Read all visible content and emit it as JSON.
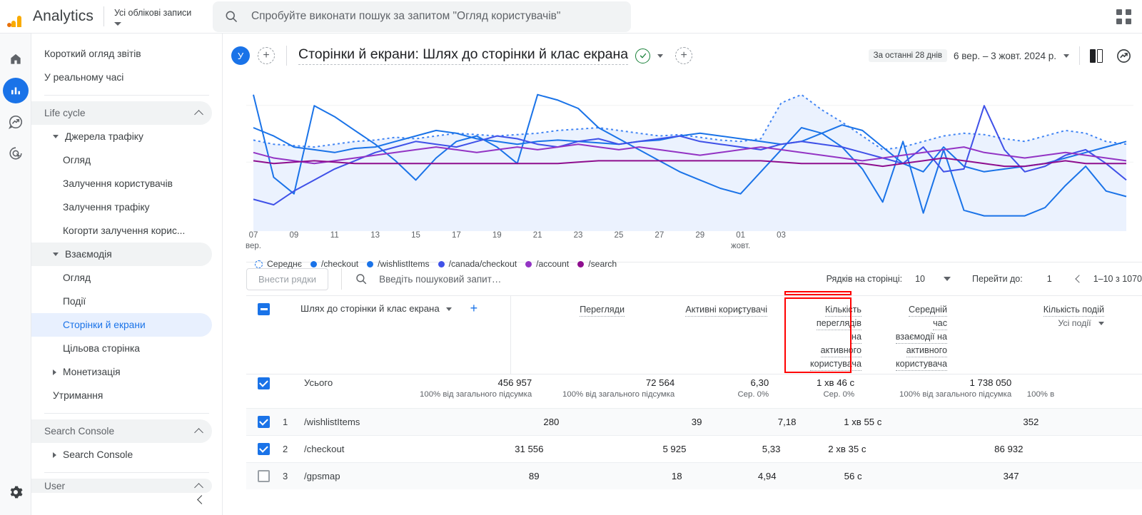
{
  "topbar": {
    "brand": "Analytics",
    "account_selector": "Усі облікові записи",
    "search_placeholder": "Спробуйте виконати пошук за запитом \"Огляд користувачів\"",
    "search_value": ""
  },
  "rail": {
    "items": [
      {
        "name": "home-icon",
        "label": "Home"
      },
      {
        "name": "reports-icon",
        "label": "Reports"
      },
      {
        "name": "explore-icon",
        "label": "Explore"
      },
      {
        "name": "advertising-icon",
        "label": "Advertising"
      }
    ],
    "settings_label": "Адміністратор"
  },
  "sidebar": {
    "items": [
      {
        "label": "Короткий огляд звітів",
        "level": 0,
        "type": "link"
      },
      {
        "label": "У реальному часі",
        "level": 0,
        "type": "link"
      },
      {
        "label": "Life cycle",
        "level": 0,
        "type": "group",
        "collapsed": false
      },
      {
        "label": "Джерела трафіку",
        "level": 1,
        "type": "expandable",
        "expanded": true
      },
      {
        "label": "Огляд",
        "level": 2,
        "type": "link"
      },
      {
        "label": "Залучення користувачів",
        "level": 2,
        "type": "link"
      },
      {
        "label": "Залучення трафіку",
        "level": 2,
        "type": "link"
      },
      {
        "label": "Когорти залучення корис...",
        "level": 2,
        "type": "link"
      },
      {
        "label": "Взаємодія",
        "level": 1,
        "type": "expandable",
        "expanded": true
      },
      {
        "label": "Огляд",
        "level": 2,
        "type": "link"
      },
      {
        "label": "Події",
        "level": 2,
        "type": "link"
      },
      {
        "label": "Сторінки й екрани",
        "level": 2,
        "type": "link",
        "selected": true
      },
      {
        "label": "Цільова сторінка",
        "level": 2,
        "type": "link"
      },
      {
        "label": "Монетизація",
        "level": 1,
        "type": "expandable",
        "expanded": false
      },
      {
        "label": "Утримання",
        "level": 1,
        "type": "link"
      },
      {
        "label": "Search Console",
        "level": 0,
        "type": "group",
        "collapsed": false
      },
      {
        "label": "Search Console",
        "level": 1,
        "type": "expandable",
        "expanded": false
      },
      {
        "label": "User",
        "level": 0,
        "type": "group",
        "collapsed": false
      }
    ]
  },
  "page_header": {
    "avatar_initial": "У",
    "add_comparison_label": "+",
    "title": "Сторінки й екрани: Шлях до сторінки й клас екрана",
    "add_filter_label": "+",
    "date_pill": "За останні 28 днів",
    "date_range": "6 вер. – 3 жовт. 2024 р."
  },
  "chart_data": {
    "type": "line",
    "title": "",
    "xlabel": "",
    "ylabel": "",
    "grid": true,
    "legend_position": "bottom",
    "x_ticks": [
      "07",
      "09",
      "11",
      "13",
      "15",
      "17",
      "19",
      "21",
      "23",
      "25",
      "27",
      "29",
      "01",
      "03"
    ],
    "x_tick_sub": {
      "07": "вер.",
      "01": "жовт."
    },
    "series": [
      {
        "name": "Середнє",
        "color": "#4285f4",
        "style": "dashed",
        "filled": true,
        "values": [
          63,
          60,
          59,
          58,
          60,
          62,
          63,
          65,
          64,
          66,
          68,
          67,
          66,
          67,
          68,
          70,
          71,
          72,
          70,
          68,
          66,
          67,
          65,
          63,
          62,
          64,
          90,
          96,
          85,
          76,
          66,
          56,
          58,
          62,
          66,
          68,
          67,
          64,
          62,
          66,
          70,
          68,
          62,
          60
        ]
      },
      {
        "name": "/checkout",
        "color": "#1a73e8",
        "style": "solid",
        "filled": false,
        "values": [
          72,
          66,
          58,
          56,
          54,
          57,
          58,
          62,
          66,
          70,
          68,
          64,
          62,
          60,
          62,
          63,
          62,
          61,
          60,
          62,
          63,
          66,
          68,
          66,
          64,
          62,
          60,
          62,
          68,
          74,
          70,
          58,
          46,
          40,
          58,
          44,
          40,
          42,
          44,
          46,
          50,
          54,
          58,
          62
        ]
      },
      {
        "name": "/wishlistItems",
        "color": "#1a73e8",
        "style": "solid",
        "filled": false,
        "values": [
          96,
          36,
          24,
          88,
          80,
          70,
          60,
          48,
          34,
          50,
          62,
          66,
          58,
          46,
          96,
          92,
          86,
          72,
          64,
          56,
          48,
          40,
          34,
          28,
          24,
          40,
          56,
          72,
          68,
          58,
          42,
          18,
          62,
          10,
          56,
          12,
          8,
          8,
          8,
          14,
          30,
          44,
          26,
          22
        ]
      },
      {
        "name": "/canada/checkout",
        "color": "#3f51e8",
        "style": "solid",
        "filled": false,
        "values": [
          20,
          16,
          26,
          34,
          42,
          48,
          54,
          58,
          62,
          60,
          58,
          62,
          66,
          64,
          60,
          58,
          62,
          64,
          60,
          62,
          64,
          66,
          62,
          60,
          58,
          56,
          60,
          62,
          60,
          58,
          54,
          50,
          46,
          58,
          40,
          42,
          88,
          56,
          40,
          44,
          52,
          56,
          46,
          34
        ]
      },
      {
        "name": "/account",
        "color": "#9334c4",
        "style": "solid",
        "filled": false,
        "values": [
          54,
          50,
          48,
          46,
          48,
          50,
          52,
          54,
          56,
          58,
          56,
          54,
          56,
          58,
          56,
          58,
          60,
          58,
          56,
          58,
          56,
          54,
          52,
          54,
          56,
          58,
          56,
          54,
          52,
          50,
          48,
          50,
          52,
          54,
          56,
          58,
          54,
          52,
          50,
          52,
          54,
          52,
          50,
          48
        ]
      },
      {
        "name": "/search",
        "color": "#8e0e8e",
        "style": "solid",
        "filled": false,
        "values": [
          48,
          46,
          47,
          48,
          47,
          46,
          46,
          46,
          46,
          46,
          46,
          46,
          46,
          46,
          46,
          46,
          47,
          48,
          48,
          48,
          48,
          48,
          48,
          48,
          48,
          48,
          47,
          46,
          46,
          46,
          46,
          44,
          46,
          48,
          50,
          48,
          46,
          44,
          44,
          46,
          48,
          46,
          46,
          46
        ]
      }
    ]
  },
  "table_controls": {
    "add_rows_label": "Внести рядки",
    "search_placeholder": "Введіть пошуковий запит…",
    "search_value": "",
    "rows_per_page_label": "Рядків на сторінці:",
    "rows_per_page_value": "10",
    "goto_label": "Перейти до:",
    "goto_value": "1",
    "range_label": "1–10 з 1070"
  },
  "table": {
    "dimension_header": "Шлях до сторінки й клас екрана",
    "columns": [
      {
        "name": "views",
        "lines": [
          "Перегляди"
        ],
        "sub": ""
      },
      {
        "name": "active-users",
        "lines": [
          "Активні користувачі"
        ],
        "sub": ""
      },
      {
        "name": "views-per-active-user",
        "lines": [
          "Кількість",
          "переглядів",
          "на",
          "активного",
          "користувача"
        ],
        "sub": "",
        "sorted": true,
        "highlighted": true
      },
      {
        "name": "avg-engagement-time",
        "lines": [
          "Середній",
          "час",
          "взаємодії на",
          "активного",
          "користувача"
        ],
        "sub": ""
      },
      {
        "name": "event-count",
        "lines": [
          "Кількість подій"
        ],
        "sub": "Усі події"
      }
    ],
    "total_row": {
      "label": "Усього",
      "checked": true,
      "values": [
        "456 957",
        "72 564",
        "6,30",
        "1 хв 46 с",
        "1 738 050",
        ""
      ],
      "subs": [
        "100% від загального підсумка",
        "100% від загального підсумка",
        "Сер. 0%",
        "Сер. 0%",
        "100% від загального підсумка",
        "100% в"
      ]
    },
    "rows": [
      {
        "index": "1",
        "checked": true,
        "name": "/wishlistItems",
        "values": [
          "280",
          "39",
          "7,18",
          "1 хв 55 с",
          "352"
        ]
      },
      {
        "index": "2",
        "checked": true,
        "name": "/checkout",
        "values": [
          "31 556",
          "5 925",
          "5,33",
          "2 хв 35 с",
          "86 932"
        ]
      },
      {
        "index": "3",
        "checked": false,
        "name": "/gpsmap",
        "values": [
          "89",
          "18",
          "4,94",
          "56 с",
          "347"
        ]
      }
    ]
  },
  "colors": {
    "accent": "#1a73e8",
    "highlight_box": "#ff0000",
    "brand_orange": "#f9ab00",
    "success_green": "#188038"
  }
}
